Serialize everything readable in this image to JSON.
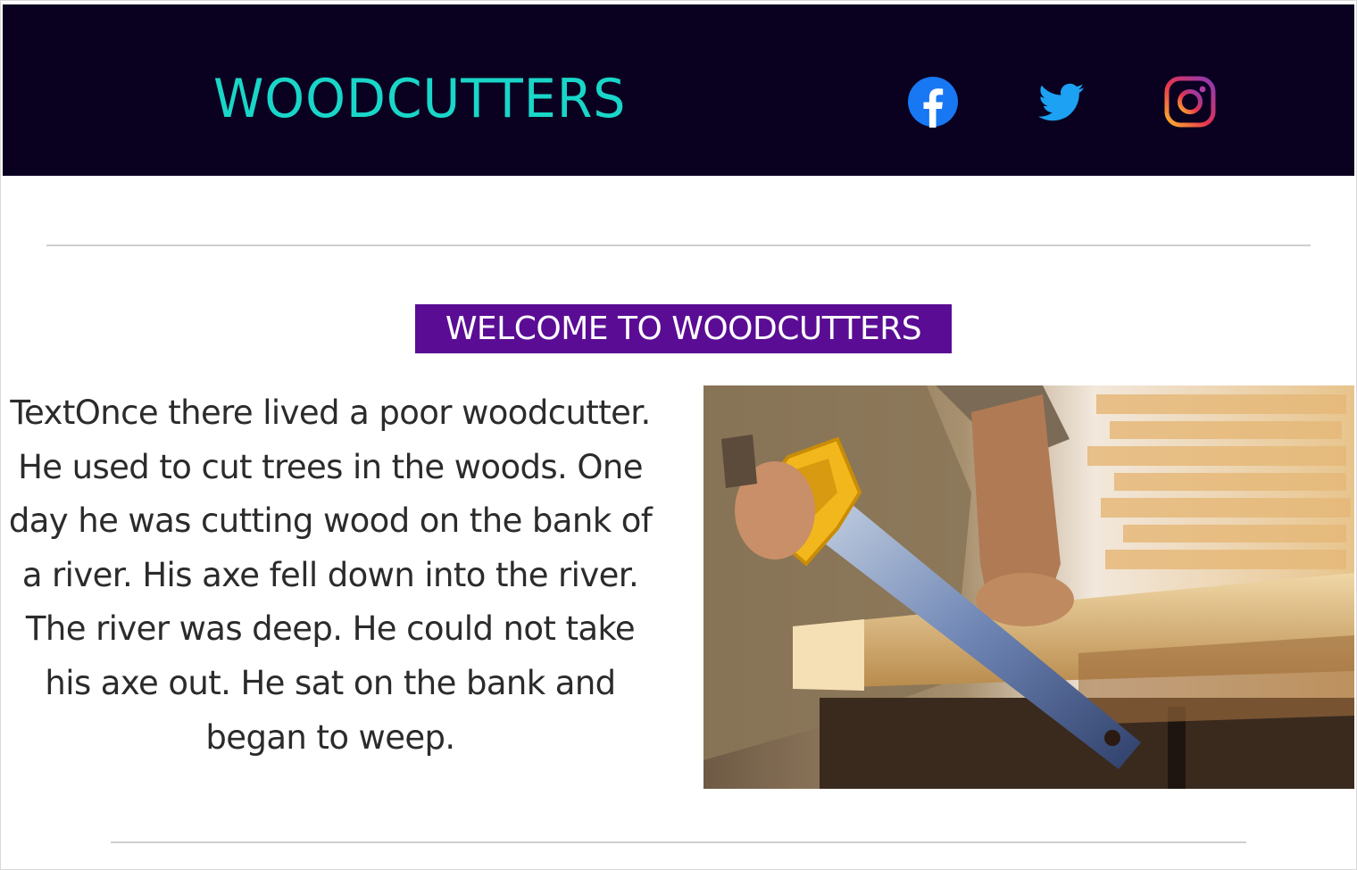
{
  "header": {
    "brand": "WOODCUTTERS",
    "background": "#0a0020",
    "brand_color": "#19d6c8",
    "social": [
      {
        "name": "facebook",
        "icon": "facebook-icon",
        "color": "#1877f2"
      },
      {
        "name": "twitter",
        "icon": "twitter-icon",
        "color": "#1da1f2"
      },
      {
        "name": "instagram",
        "icon": "instagram-icon",
        "color": "#e1306c"
      }
    ]
  },
  "main": {
    "welcome_label": "WELCOME TO WOODCUTTERS",
    "welcome_bg": "#5a0d94",
    "story": "TextOnce there lived a poor woodcutter. He used to cut trees in the woods. One day he was cutting wood on the bank of a river. His axe fell down into the river. The river was deep. He could not take his axe out. He sat on the bank and began to weep.",
    "photo": "woodworker-sawing-plank-image"
  }
}
